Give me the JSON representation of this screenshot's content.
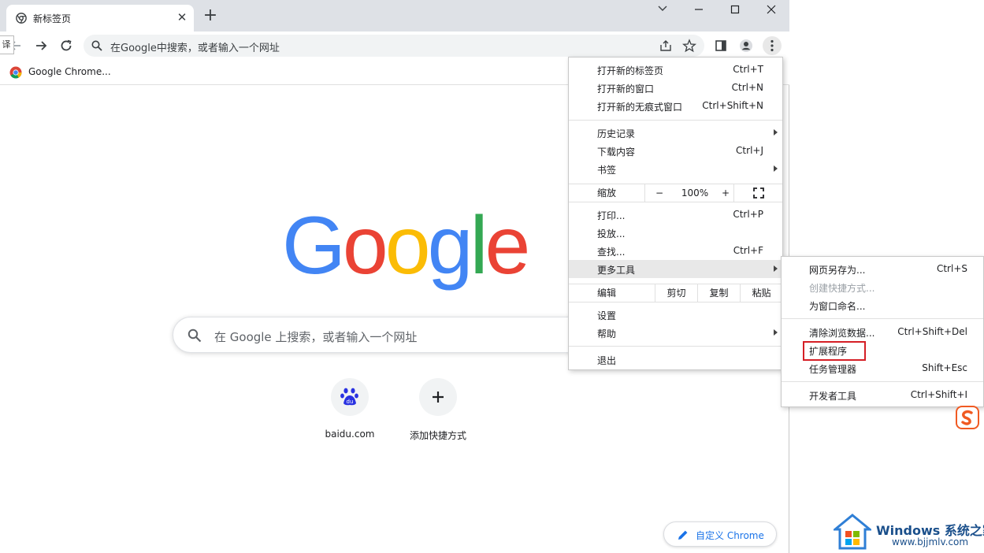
{
  "tab": {
    "title": "新标签页",
    "close": "✕",
    "new_tab": "+"
  },
  "toolbar": {
    "translate_chip": "译",
    "omnibox_placeholder": "在Google中搜索，或者输入一个网址"
  },
  "bookmarks": [
    {
      "label": "Google Chrome..."
    }
  ],
  "ntp": {
    "logo": [
      "G",
      "o",
      "o",
      "g",
      "l",
      "e"
    ],
    "logo_colors": [
      "#4285f4",
      "#ea4335",
      "#fbbc05",
      "#4285f4",
      "#34a853",
      "#ea4335"
    ],
    "search_placeholder": "在 Google 上搜索，或者输入一个网址",
    "shortcuts": [
      {
        "label": "baidu.com",
        "icon": "baidu-paw-icon"
      },
      {
        "label": "添加快捷方式",
        "icon": "plus-icon"
      }
    ],
    "customize_label": "自定义 Chrome"
  },
  "menu": {
    "group1": [
      {
        "label": "打开新的标签页",
        "shortcut": "Ctrl+T"
      },
      {
        "label": "打开新的窗口",
        "shortcut": "Ctrl+N"
      },
      {
        "label": "打开新的无痕式窗口",
        "shortcut": "Ctrl+Shift+N"
      }
    ],
    "group2": [
      {
        "label": "历史记录",
        "shortcut": ""
      },
      {
        "label": "下载内容",
        "shortcut": "Ctrl+J"
      },
      {
        "label": "书签",
        "shortcut": ""
      }
    ],
    "zoom": {
      "label": "缩放",
      "minus": "−",
      "value": "100%",
      "plus": "+"
    },
    "group3": [
      {
        "label": "打印...",
        "shortcut": "Ctrl+P"
      },
      {
        "label": "投放...",
        "shortcut": ""
      },
      {
        "label": "查找...",
        "shortcut": "Ctrl+F"
      },
      {
        "label": "更多工具",
        "shortcut": ""
      }
    ],
    "edit": {
      "label": "编辑",
      "cut": "剪切",
      "copy": "复制",
      "paste": "粘贴"
    },
    "group4": [
      {
        "label": "设置",
        "shortcut": ""
      },
      {
        "label": "帮助",
        "shortcut": ""
      }
    ],
    "exit": {
      "label": "退出"
    }
  },
  "submenu": {
    "group1": [
      {
        "label": "网页另存为...",
        "shortcut": "Ctrl+S"
      },
      {
        "label": "创建快捷方式...",
        "shortcut": ""
      },
      {
        "label": "为窗口命名...",
        "shortcut": ""
      }
    ],
    "group2": [
      {
        "label": "清除浏览数据...",
        "shortcut": "Ctrl+Shift+Del"
      },
      {
        "label": "扩展程序",
        "shortcut": ""
      },
      {
        "label": "任务管理器",
        "shortcut": "Shift+Esc"
      }
    ],
    "group3": [
      {
        "label": "开发者工具",
        "shortcut": "Ctrl+Shift+I"
      }
    ]
  },
  "watermark": {
    "title": "Windows 系统之家",
    "url": "www.bjjmlv.com"
  },
  "colors": {
    "highlight": "#d51f26",
    "accent": "#1a73e8"
  }
}
